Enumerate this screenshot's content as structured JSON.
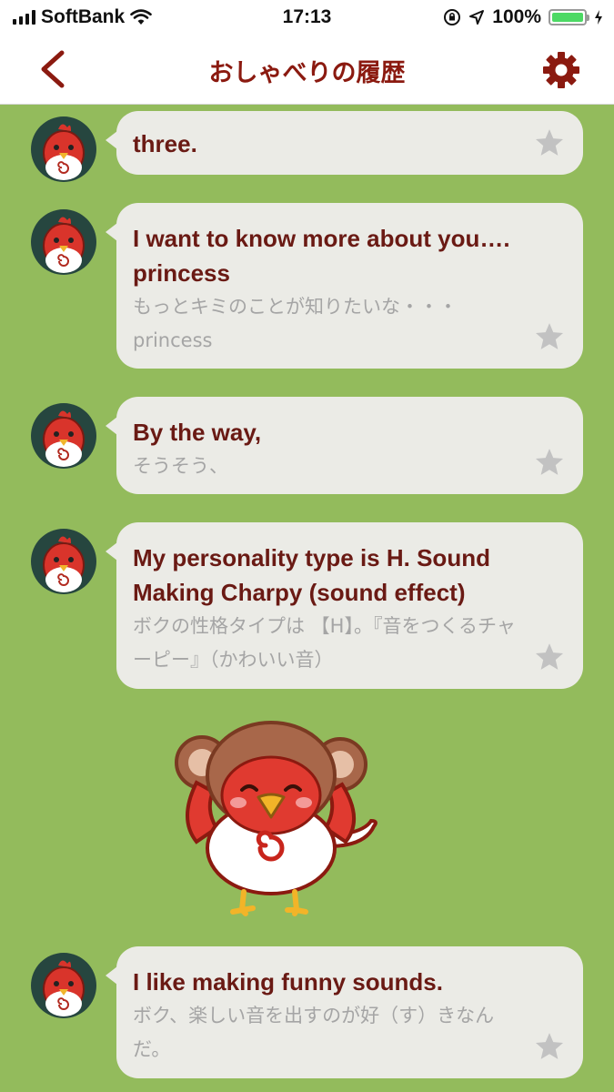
{
  "status": {
    "carrier": "SoftBank",
    "time": "17:13",
    "battery": "100%"
  },
  "nav": {
    "title": "おしゃべりの履歴"
  },
  "messages": [
    {
      "en": "three.",
      "ja": ""
    },
    {
      "en": "I want to know more about you…. princess",
      "ja": "もっとキミのことが知りたいな・・・princess"
    },
    {
      "en": "By the way,",
      "ja": "そうそう、"
    },
    {
      "en": "My personality type is H. Sound Making Charpy (sound effect)",
      "ja": "ボクの性格タイプは 【H】。『音をつくるチャーピー』（かわいい音）"
    },
    {
      "en": "I like making funny sounds.",
      "ja": "ボク、楽しい音を出すのが好（す）きなんだ。"
    }
  ],
  "icons": {
    "back": "chevron-left-icon",
    "settings": "gear-icon",
    "favorite": "star-icon"
  },
  "colors": {
    "background": "#93bb5c",
    "accent": "#8b1a10",
    "bubble": "#ebebe6",
    "star": "#c2c2c2"
  }
}
